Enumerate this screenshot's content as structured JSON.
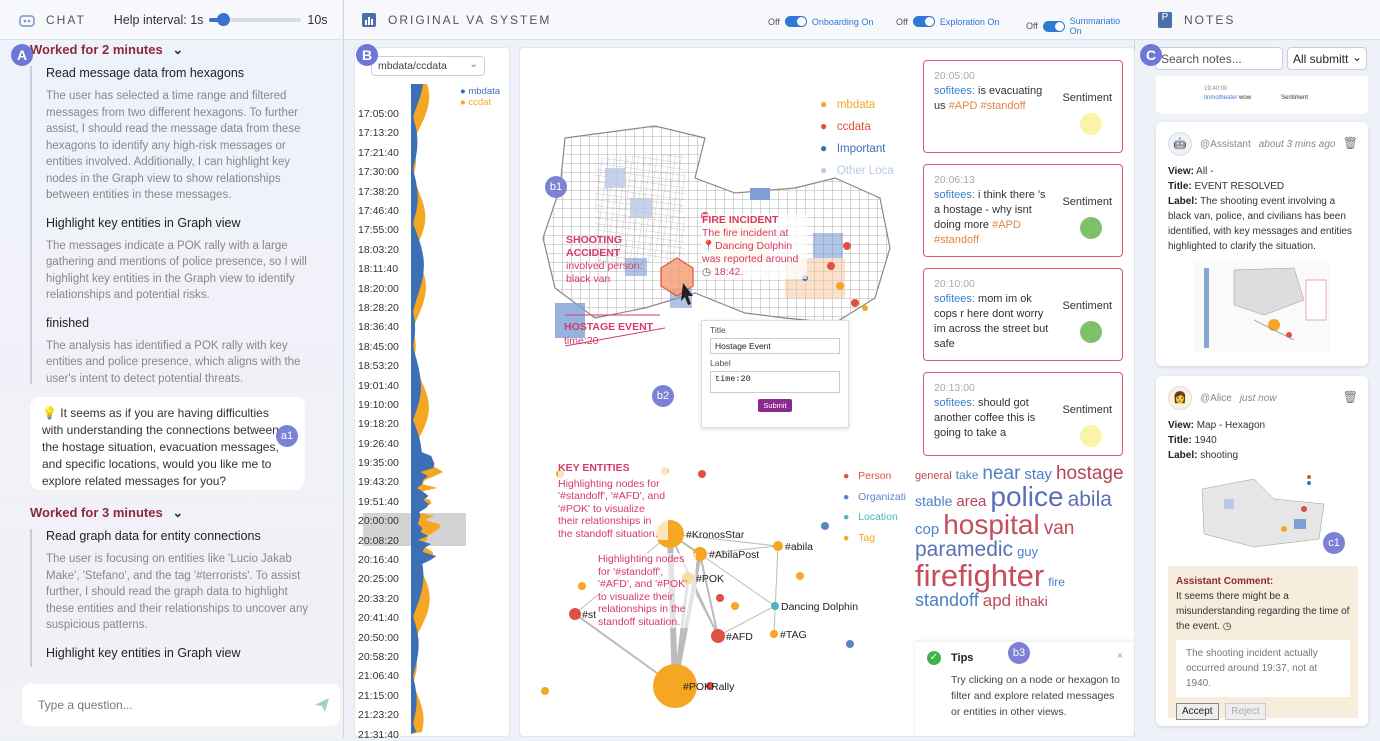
{
  "chat": {
    "header": "CHAT",
    "help_interval_label": "Help interval: 1s",
    "help_interval_max": "10s",
    "help_interval_fraction": 0.15,
    "worked1": "Worked for 2 minutes",
    "steps1": [
      {
        "title": "Read message data from hexagons",
        "body": "The user has selected a time range and filtered messages from two different hexagons. To further assist, I should read the message data from these hexagons to identify any high-risk messages or entities involved. Additionally, I can highlight key nodes in the Graph view to show relationships between entities in these messages."
      },
      {
        "title": "Highlight key entities in Graph view",
        "body": "The messages indicate a POK rally with a large gathering and mentions of police presence, so I will highlight key entities in the Graph view to identify relationships and potential risks."
      },
      {
        "title": "finished",
        "body": "The analysis has identified a POK rally with key entities and police presence, which aligns with the user's intent to detect potential threats."
      }
    ],
    "bubble": "It seems as if you are having difficulties with understanding the connections between the hostage situation, evacuation messages, and specific locations, would you like me to explore related messages for you?",
    "worked2": "Worked for 3 minutes",
    "steps2": [
      {
        "title": "Read graph data for entity connections",
        "body": "The user is focusing on entities like 'Lucio Jakab Make', 'Stefano', and the tag '#terrorists'. To assist further, I should read the graph data to highlight these entities and their relationships to uncover any suspicious patterns."
      },
      {
        "title": "Highlight key entities in Graph view",
        "body": ""
      }
    ],
    "input_placeholder": "Type a question..."
  },
  "labels": {
    "A": "A",
    "B": "B",
    "C": "C",
    "a1": "a1",
    "b1": "b1",
    "b2": "b2",
    "b3": "b3",
    "c1": "c1"
  },
  "va": {
    "header": "ORIGINAL VA SYSTEM",
    "toggles": [
      {
        "off": "Off",
        "on": "Onboarding On"
      },
      {
        "off": "Off",
        "on": "Exploration On"
      },
      {
        "off": "Off",
        "on": "Summariatio On"
      }
    ],
    "dataset": "mbdata/ccdata",
    "legend_small": [
      "mbdata",
      "ccdat"
    ],
    "ticks": [
      "17:05:00",
      "17:13:20",
      "17:21:40",
      "17:30:00",
      "17:38:20",
      "17:46:40",
      "17:55:00",
      "18:03:20",
      "18:11:40",
      "18:20:00",
      "18:28:20",
      "18:36:40",
      "18:45:00",
      "18:53:20",
      "19:01:40",
      "19:10:00",
      "19:18:20",
      "19:26:40",
      "19:35:00",
      "19:43:20",
      "19:51:40",
      "20:00:00",
      "20:08:20",
      "20:16:40",
      "20:25:00",
      "20:33:20",
      "20:41:40",
      "20:50:00",
      "20:58:20",
      "21:06:40",
      "21:15:00",
      "21:23:20",
      "21:31:40"
    ],
    "map_legend": [
      "mbdata",
      "ccdata",
      "Important",
      "Other Loca"
    ],
    "map_colors": [
      "#f5a623",
      "#e0513f",
      "#3c6fb6",
      "#b9c9e6"
    ],
    "fire_title": "FIRE INCIDENT",
    "fire_text": "The fire incident at",
    "fire_place": "Dancing Dolphin",
    "fire_text2": "was reported around",
    "fire_time": "18:42.",
    "shoot_title": "SHOOTING ACCIDENT",
    "shoot_text": "involved person: black van",
    "hostage_title": "HOSTAGE EVENT",
    "hostage_time": "time:20",
    "form_title_label": "Title",
    "form_title_value": "Hostage Event",
    "form_label_label": "Label",
    "form_label_value": "time:20",
    "form_submit": "Submit",
    "messages": [
      {
        "time": "20:05:00",
        "user": "sofitees:",
        "text": " is evacuating us ",
        "tags": "#APD #standoff",
        "sentiment": "Sentiment",
        "color": "#fbf3a8"
      },
      {
        "time": "20:06:13",
        "user": "sofitees:",
        "text": " i think there 's a hostage - why isnt doing more ",
        "tags": "#APD #standoff",
        "sentiment": "Sentiment",
        "color": "#7dc26a"
      },
      {
        "time": "20:10:00",
        "user": "sofitees:",
        "text": " mom im ok cops r here dont worry im across the street but safe",
        "tags": "",
        "sentiment": "Sentiment",
        "color": "#7dc26a"
      },
      {
        "time": "20:13:00",
        "user": "sofitees:",
        "text": " should got another coffee this is going to take a",
        "tags": "",
        "sentiment": "Sentiment",
        "color": "#fbf3a8"
      }
    ],
    "key_title": "KEY ENTITIES",
    "key_text": "Highlighting nodes for '#standoff', '#AFD', and '#POK' to visualize their relationships in the standoff situation.",
    "graph_legend": [
      "Person",
      "Organizati",
      "Location",
      "Tag"
    ],
    "graph_colors": [
      "#e0513f",
      "#5b84c4",
      "#4bb7c2",
      "#f5a623"
    ],
    "nodes": [
      "#KronosStar",
      "#AbilaPost",
      "#POK",
      "#abila",
      "#st",
      "#AFD",
      "#TAG",
      "Dancing Dolphin",
      "#POKRally"
    ],
    "words": [
      {
        "t": "general",
        "s": 11,
        "c": "#c04a5a"
      },
      {
        "t": "take",
        "s": 12,
        "c": "#4a7fc9"
      },
      {
        "t": "near",
        "s": 19,
        "c": "#4a7fc9"
      },
      {
        "t": "stay",
        "s": 15,
        "c": "#4a7fc9"
      },
      {
        "t": "hostage",
        "s": 19,
        "c": "#b8425a"
      },
      {
        "t": "stable",
        "s": 14,
        "c": "#4a7fc9"
      },
      {
        "t": "area",
        "s": 15,
        "c": "#b8425a"
      },
      {
        "t": "police",
        "s": 28,
        "c": "#5a6fb5"
      },
      {
        "t": "abila",
        "s": 21,
        "c": "#5a6fb5"
      },
      {
        "t": "cop",
        "s": 15,
        "c": "#4a7fc9"
      },
      {
        "t": "hospital",
        "s": 28,
        "c": "#c64d5e"
      },
      {
        "t": "van",
        "s": 19,
        "c": "#c04a5a"
      },
      {
        "t": "paramedic",
        "s": 21,
        "c": "#5a6fb5"
      },
      {
        "t": "guy",
        "s": 13,
        "c": "#4a7fc9"
      },
      {
        "t": "firefighter",
        "s": 31,
        "c": "#c64d5e"
      },
      {
        "t": "fire",
        "s": 12,
        "c": "#4a7fc9"
      },
      {
        "t": "standoff",
        "s": 18,
        "c": "#4a7fc9"
      },
      {
        "t": "apd",
        "s": 17,
        "c": "#c04a5a"
      },
      {
        "t": "ithaki",
        "s": 14,
        "c": "#b8425a"
      }
    ],
    "tips_title": "Tips",
    "tips_text": "Try clicking on a node or hexagon to filter and explore related messages or entities in other views."
  },
  "notes": {
    "header": "NOTES",
    "search_placeholder": "Search notes...",
    "filter": "All submitt",
    "card1": {
      "user": "@Assistant",
      "time": "about 3 mins ago",
      "view": "All -",
      "title": "EVENT RESOLVED",
      "label": "The shooting event involving a black van, police, and civilians has been identified, with key messages and entities highlighted to clarify the situation."
    },
    "card2": {
      "user": "@Alice",
      "time": "just now",
      "view": "Map - Hexagon",
      "title": "1940",
      "label": "shooting",
      "comment_title": "Assistant Comment:",
      "comment": "It seems there might be a misunderstanding regarding the time of the event.",
      "quote": "The shooting incident actually occurred around 19:37, not at 1940.",
      "accept": "Accept",
      "reject": "Reject"
    },
    "strip": {
      "time": "19:40:00",
      "user": "tinmotheater",
      "text": "wow",
      "sentiment": "Sentiment"
    },
    "view_label": "View:",
    "title_label": "Title:",
    "label_label": "Label:"
  }
}
